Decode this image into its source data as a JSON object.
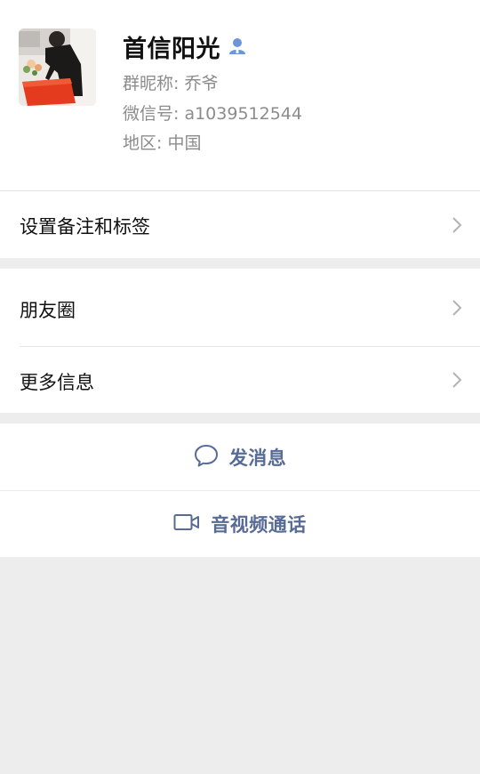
{
  "profile": {
    "display_name": "首信阳光",
    "nickname_label": "群昵称:",
    "nickname_value": "乔爷",
    "wechat_id_label": "微信号:",
    "wechat_id_value": "a1039512544",
    "region_label": "地区:",
    "region_value": "中国",
    "badge_icon": "person-icon",
    "badge_color": "#6f95d8"
  },
  "menu": {
    "remark_tags": "设置备注和标签",
    "moments": "朋友圈",
    "more_info": "更多信息"
  },
  "actions": {
    "send_message": "发消息",
    "video_call": "音视频通话",
    "link_color": "#576b95"
  },
  "icons": {
    "chevron": "chevron-right-icon",
    "message": "chat-bubble-icon",
    "video": "video-camera-icon"
  }
}
